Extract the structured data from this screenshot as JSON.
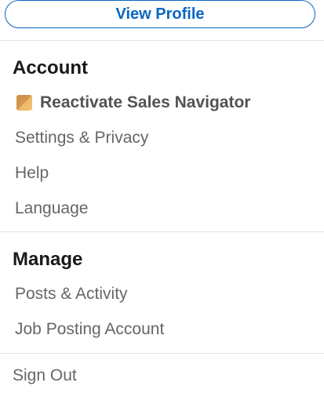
{
  "header": {
    "view_profile_label": "View Profile"
  },
  "account": {
    "title": "Account",
    "items": [
      {
        "label": "Reactivate Sales Navigator",
        "icon": "premium-icon"
      },
      {
        "label": "Settings & Privacy"
      },
      {
        "label": "Help"
      },
      {
        "label": "Language"
      }
    ]
  },
  "manage": {
    "title": "Manage",
    "items": [
      {
        "label": "Posts & Activity"
      },
      {
        "label": "Job Posting Account"
      }
    ]
  },
  "footer": {
    "sign_out_label": "Sign Out"
  },
  "colors": {
    "accent": "#0a66c2",
    "text_primary": "#191919",
    "text_secondary": "#666666",
    "premium_gold": "#e8b768",
    "divider": "#e3e3e3"
  }
}
